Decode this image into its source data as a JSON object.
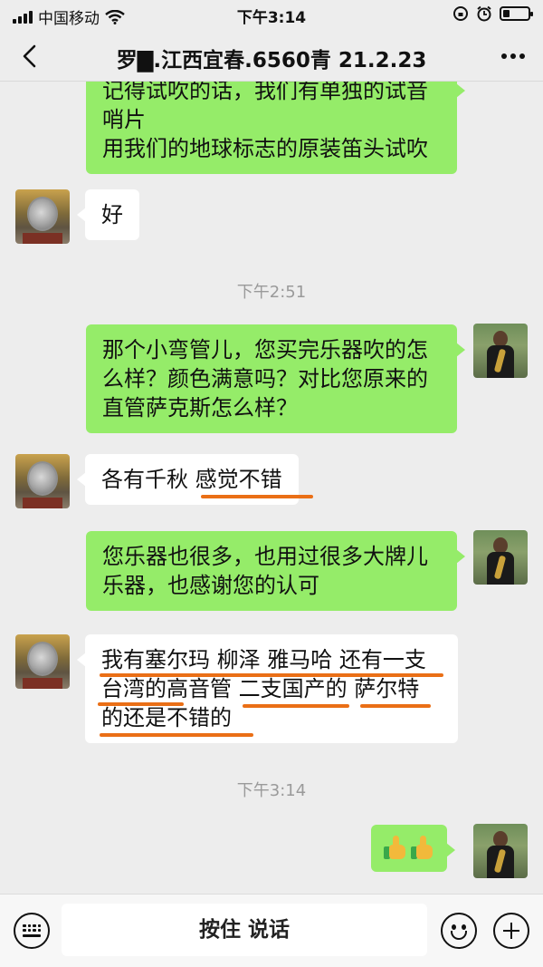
{
  "status_bar": {
    "carrier": "中国移动",
    "time": "下午3:14",
    "battery_level": 0.25
  },
  "header": {
    "title": "罗▇.江西宜春.6560青 21.2.23",
    "back_icon": "chevron-left-icon",
    "more_icon": "more-dots-icon"
  },
  "messages": [
    {
      "from": "self",
      "lines": [
        "记得试吹的话，我们有单独的试音",
        "哨片",
        "用我们的地球标志的原装笛头试吹"
      ]
    },
    {
      "from": "other",
      "lines": [
        "好"
      ]
    },
    {
      "type": "time",
      "text": "下午2:51"
    },
    {
      "from": "self",
      "lines": [
        "那个小弯管儿，您买完乐器吹的怎",
        "么样？颜色满意吗？对比您原来的",
        "直管萨克斯怎么样？"
      ]
    },
    {
      "from": "other",
      "lines": [
        "各有千秋 感觉不错"
      ]
    },
    {
      "from": "self",
      "lines": [
        "您乐器也很多，也用过很多大牌儿",
        "乐器，也感谢您的认可"
      ]
    },
    {
      "from": "other",
      "lines": [
        "我有塞尔玛 柳泽  雅马哈 还有一支",
        "台湾的高音管 二支国产的 萨尔特",
        "的还是不错的"
      ]
    },
    {
      "type": "time",
      "text": "下午3:14"
    },
    {
      "from": "self",
      "emoji": [
        "thumbs-up",
        "thumbs-up"
      ]
    }
  ],
  "input_bar": {
    "hold_to_talk": "按住 说话",
    "keyboard_icon": "keyboard-icon",
    "emoji_icon": "emoji-icon",
    "plus_icon": "plus-icon"
  },
  "colors": {
    "background": "#ededed",
    "self_bubble": "#95ec69",
    "other_bubble": "#ffffff",
    "underline_marks": "#ea6f16"
  }
}
